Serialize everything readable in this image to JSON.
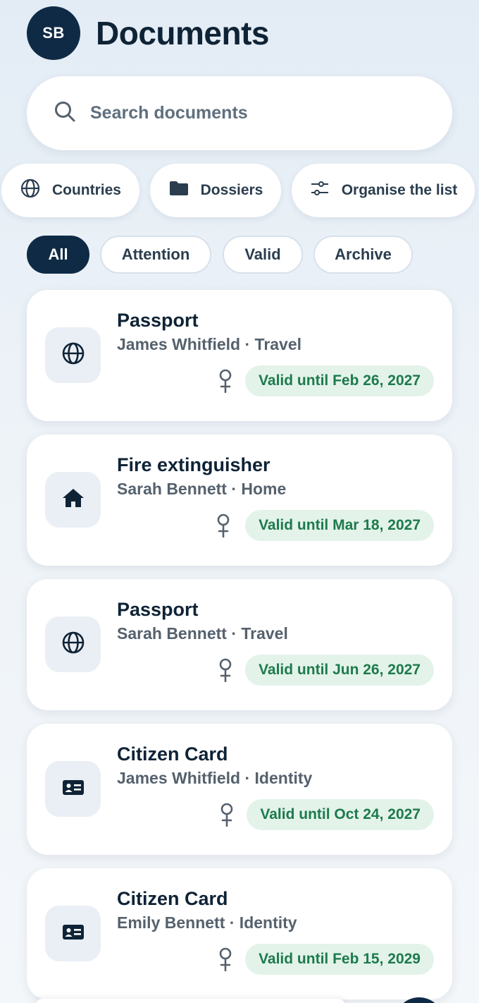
{
  "header": {
    "avatar_initials": "SB",
    "title": "Documents"
  },
  "search": {
    "placeholder": "Search documents",
    "value": "",
    "icon": "search-icon"
  },
  "filters": [
    {
      "label": "Countries",
      "icon": "globe-icon"
    },
    {
      "label": "Dossiers",
      "icon": "folder-icon"
    },
    {
      "label": "Organise the list",
      "icon": "sliders-icon"
    }
  ],
  "tabs": [
    {
      "label": "All",
      "active": true
    },
    {
      "label": "Attention",
      "active": false
    },
    {
      "label": "Valid",
      "active": false
    },
    {
      "label": "Archive",
      "active": false
    }
  ],
  "documents": [
    {
      "title": "Passport",
      "subtitle": "James Whitfield · Travel",
      "icon": "globe-icon",
      "gender_icon": "female-symbol-icon",
      "status": "Valid until Feb 26, 2027"
    },
    {
      "title": "Fire extinguisher",
      "subtitle": "Sarah Bennett · Home",
      "icon": "home-icon",
      "gender_icon": "female-symbol-icon",
      "status": "Valid until Mar 18, 2027"
    },
    {
      "title": "Passport",
      "subtitle": "Sarah Bennett · Travel",
      "icon": "globe-icon",
      "gender_icon": "female-symbol-icon",
      "status": "Valid until Jun 26, 2027"
    },
    {
      "title": "Citizen Card",
      "subtitle": "James Whitfield · Identity",
      "icon": "id-card-icon",
      "gender_icon": "female-symbol-icon",
      "status": "Valid until Oct 24, 2027"
    },
    {
      "title": "Citizen Card",
      "subtitle": "Emily Bennett · Identity",
      "icon": "id-card-icon",
      "gender_icon": "female-symbol-icon",
      "status": "Valid until Feb 15, 2029"
    }
  ],
  "colors": {
    "primary": "#0f2a45",
    "status_bg": "#e3f3ea",
    "status_text": "#1d7a4c",
    "background": "#eef3f8"
  }
}
